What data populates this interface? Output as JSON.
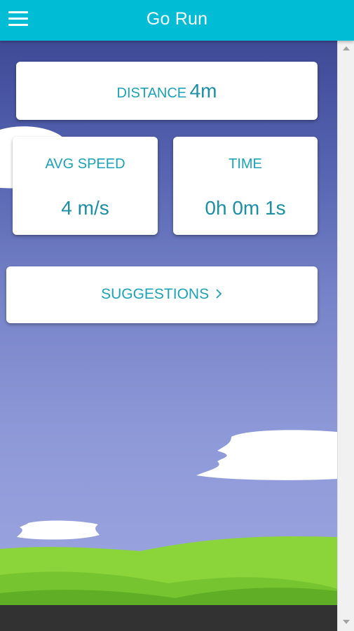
{
  "header": {
    "title": "Go Run",
    "menu_icon": "hamburger-menu-icon"
  },
  "stats": {
    "distance": {
      "label": "DISTANCE",
      "value": "4m"
    },
    "avg_speed": {
      "label": "AVG SPEED",
      "value": "4 m/s"
    },
    "time": {
      "label": "TIME",
      "value": "0h 0m 1s"
    }
  },
  "suggestions": {
    "label": "SUGGESTIONS",
    "icon": "chevron-right-icon"
  },
  "colors": {
    "header": "#00bcd4",
    "card_text": "#1aa3b8",
    "sky_top": "#3f4a96",
    "sky_bottom": "#9ca5e0",
    "grass": "#8bd43a",
    "ground": "#323232"
  }
}
